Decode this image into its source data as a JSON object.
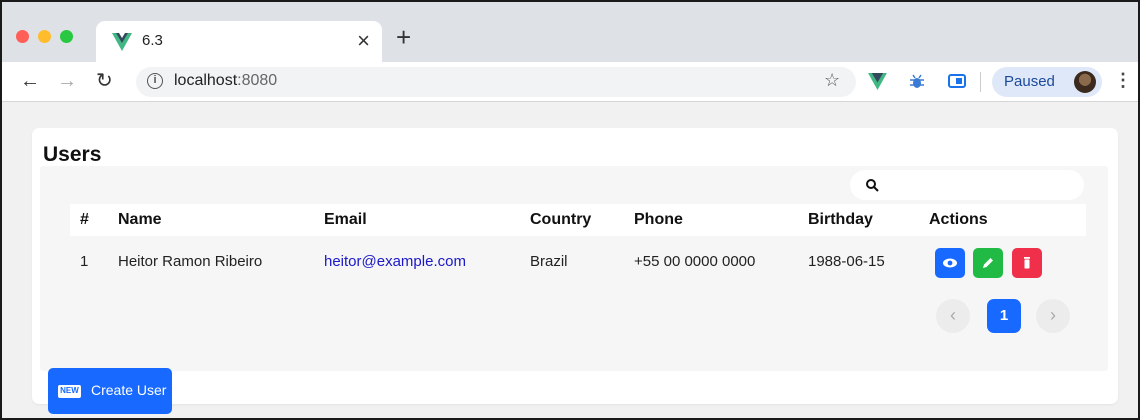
{
  "browser": {
    "tab_title": "6.3",
    "new_tab_symbol": "+",
    "close_symbol": "×",
    "url_host": "localhost",
    "url_port": ":8080",
    "profile_status": "Paused",
    "traffic_lights": [
      "#ff5f57",
      "#ffbd2e",
      "#28c840"
    ]
  },
  "page": {
    "title": "Users",
    "search": {
      "value": "",
      "placeholder": ""
    },
    "table": {
      "columns": [
        "#",
        "Name",
        "Email",
        "Country",
        "Phone",
        "Birthday",
        "Actions"
      ],
      "rows": [
        {
          "num": "1",
          "name": "Heitor Ramon Ribeiro",
          "email": "heitor@example.com",
          "country": "Brazil",
          "phone": "+55 00 0000 0000",
          "birthday": "1988-06-15"
        }
      ],
      "actions": [
        {
          "name": "view",
          "icon": "eye-icon",
          "color": "#1769ff"
        },
        {
          "name": "edit",
          "icon": "pencil-icon",
          "color": "#21ba45"
        },
        {
          "name": "delete",
          "icon": "trash-icon",
          "color": "#f0304a"
        }
      ]
    },
    "pagination": {
      "current_page": "1",
      "prev": "‹",
      "next": "›"
    },
    "create_button": {
      "badge": "NEW",
      "label": "Create User"
    }
  },
  "colors": {
    "accent": "#1769ff",
    "link": "#1a18c8"
  }
}
